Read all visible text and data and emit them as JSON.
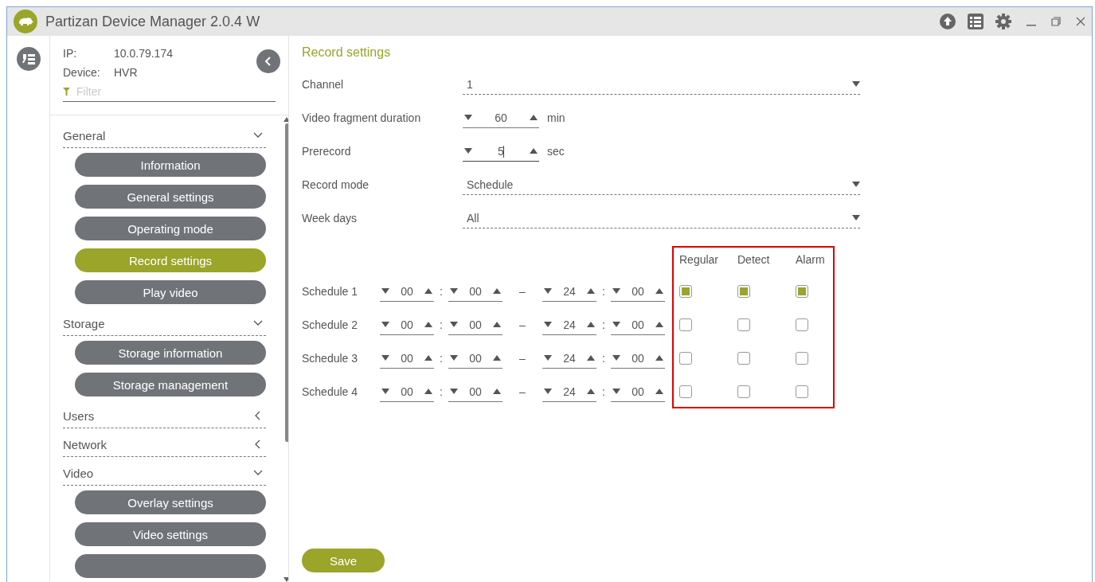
{
  "window": {
    "title": "Partizan Device Manager 2.0.4 W"
  },
  "device": {
    "ip_label": "IP:",
    "ip": "10.0.79.174",
    "device_label": "Device:",
    "device": "HVR",
    "filter": {
      "placeholder": "Filter"
    }
  },
  "sidebar": {
    "sections": [
      {
        "label": "General",
        "expanded": true,
        "items": [
          {
            "label": "Information",
            "selected": false
          },
          {
            "label": "General settings",
            "selected": false
          },
          {
            "label": "Operating mode",
            "selected": false
          },
          {
            "label": "Record settings",
            "selected": true
          },
          {
            "label": "Play video",
            "selected": false
          }
        ]
      },
      {
        "label": "Storage",
        "expanded": true,
        "items": [
          {
            "label": "Storage information",
            "selected": false
          },
          {
            "label": "Storage management",
            "selected": false
          }
        ]
      },
      {
        "label": "Users",
        "expanded": false
      },
      {
        "label": "Network",
        "expanded": false
      },
      {
        "label": "Video",
        "expanded": true,
        "items": [
          {
            "label": "Overlay settings",
            "selected": false
          },
          {
            "label": "Video settings",
            "selected": false
          }
        ]
      }
    ]
  },
  "content": {
    "title": "Record settings",
    "fields": [
      {
        "kind": "dropdown",
        "label": "Channel",
        "value": "1"
      },
      {
        "kind": "spinner",
        "label": "Video fragment duration",
        "value": "60",
        "unit": "min",
        "focused": false
      },
      {
        "kind": "spinner",
        "label": "Prerecord",
        "value": "5",
        "unit": "sec",
        "focused": true
      },
      {
        "kind": "dropdown",
        "label": "Record mode",
        "value": "Schedule"
      },
      {
        "kind": "dropdown",
        "label": "Week days",
        "value": "All"
      }
    ],
    "schedule": {
      "columns": [
        "Regular",
        "Detect",
        "Alarm"
      ],
      "time_separator": ":",
      "range_separator": "–",
      "rows": [
        {
          "label": "Schedule 1",
          "start_hour": "00",
          "start_minute": "00",
          "end_hour": "24",
          "end_minute": "00",
          "checks": [
            true,
            true,
            true
          ]
        },
        {
          "label": "Schedule 2",
          "start_hour": "00",
          "start_minute": "00",
          "end_hour": "24",
          "end_minute": "00",
          "checks": [
            false,
            false,
            false
          ]
        },
        {
          "label": "Schedule 3",
          "start_hour": "00",
          "start_minute": "00",
          "end_hour": "24",
          "end_minute": "00",
          "checks": [
            false,
            false,
            false
          ]
        },
        {
          "label": "Schedule 4",
          "start_hour": "00",
          "start_minute": "00",
          "end_hour": "24",
          "end_minute": "00",
          "checks": [
            false,
            false,
            false
          ]
        }
      ]
    },
    "save_button": "Save"
  }
}
